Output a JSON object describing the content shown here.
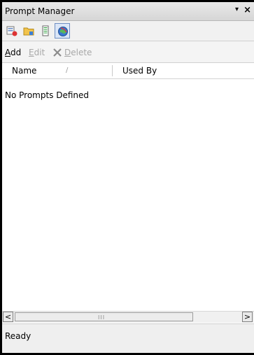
{
  "window": {
    "title": "Prompt Manager",
    "pin_glyph": "▾",
    "close_glyph": "×"
  },
  "toolbar_icons": [
    {
      "name": "prompt-list-icon",
      "active": false
    },
    {
      "name": "folder-icon",
      "active": false
    },
    {
      "name": "document-icon",
      "active": false
    },
    {
      "name": "globe-icon",
      "active": true
    }
  ],
  "actions": {
    "add": {
      "first": "A",
      "rest": "dd",
      "enabled": true
    },
    "edit": {
      "first": "E",
      "rest": "dit",
      "enabled": false
    },
    "delete": {
      "first": "D",
      "rest": "elete",
      "enabled": false
    }
  },
  "list": {
    "columns": [
      {
        "label": "Name",
        "sort_indicator": "/"
      },
      {
        "label": "Used By"
      }
    ],
    "empty_text": "No Prompts Defined"
  },
  "scrollbar": {
    "left_arrow": "<",
    "right_arrow": ">",
    "grip": "III"
  },
  "statusbar": {
    "text": "Ready"
  }
}
